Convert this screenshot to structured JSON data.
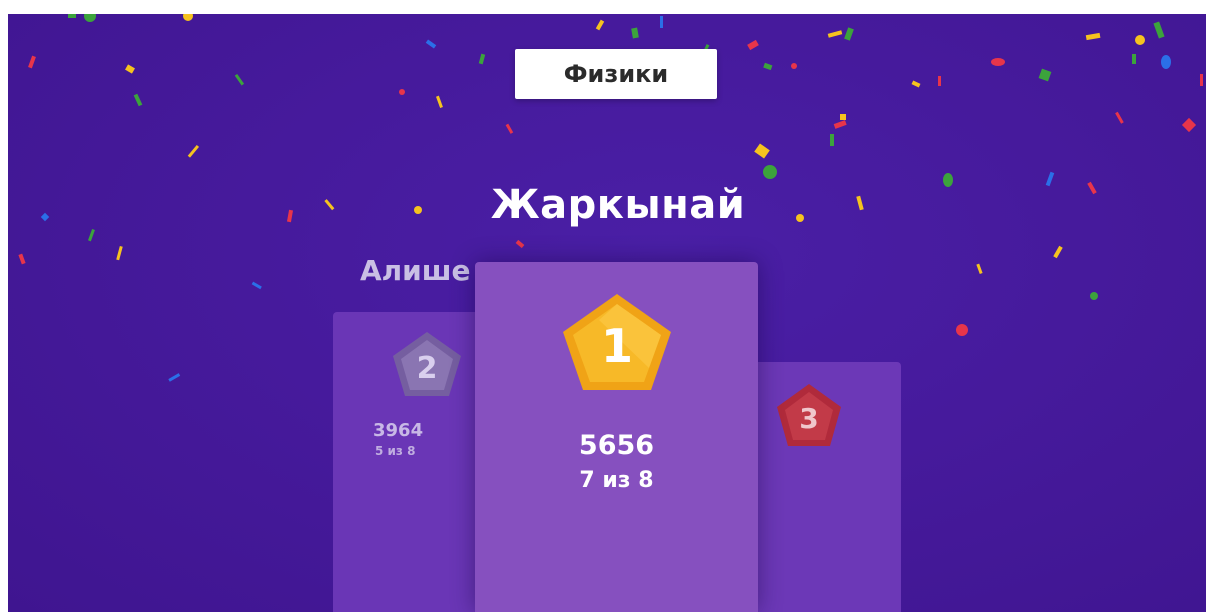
{
  "quiz": {
    "title": "Физики"
  },
  "podium": {
    "first": {
      "rank": "1",
      "name": "Жаркынай",
      "score": "5656",
      "progress": "7 из 8",
      "color": "#f6b11f"
    },
    "second": {
      "rank": "2",
      "name": "Алише",
      "score": "3964",
      "progress": "5 из 8",
      "color": "#7a62a8"
    },
    "third": {
      "rank": "3",
      "color": "#c0333d"
    }
  },
  "colors": {
    "background": "#461a9c",
    "podium_first": "#8650bf",
    "podium_side": "#6a36b6"
  }
}
